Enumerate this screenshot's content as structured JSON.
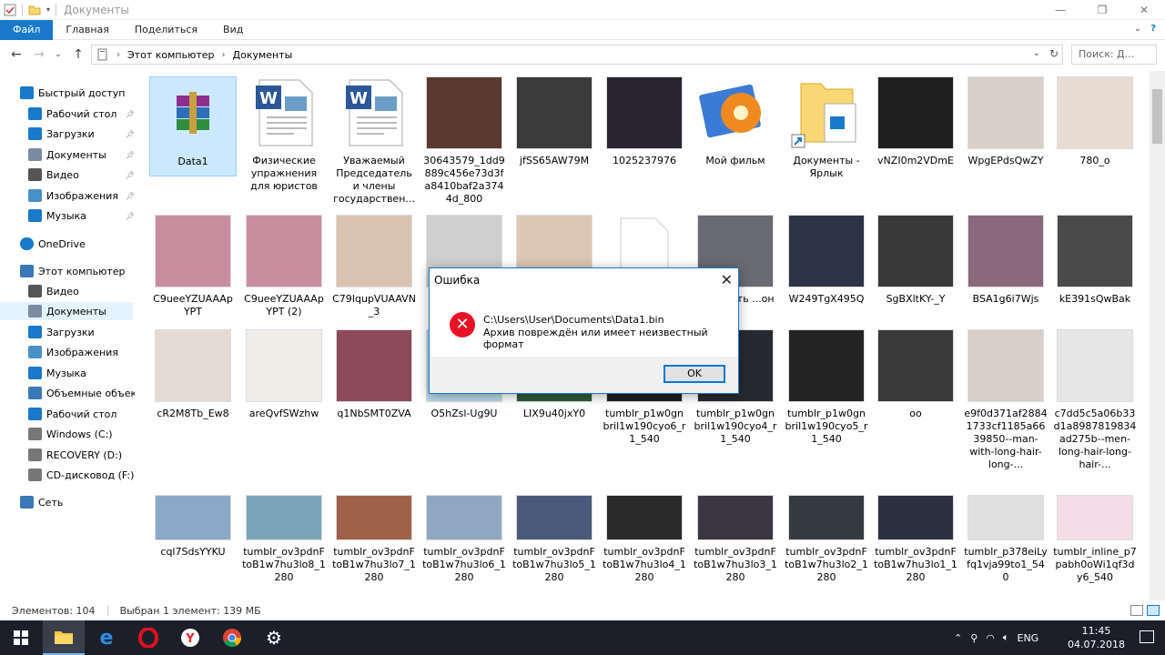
{
  "window": {
    "title": "Документы",
    "minimize": "—",
    "maximize": "❐",
    "close": "✕"
  },
  "ribbon": {
    "tabs": [
      "Файл",
      "Главная",
      "Поделиться",
      "Вид"
    ]
  },
  "address": {
    "crumbs": [
      "Этот компьютер",
      "Документы"
    ],
    "search_placeholder": "Поиск: Д..."
  },
  "sidebar": {
    "items": [
      {
        "label": "Быстрый доступ",
        "icon": "star-icon"
      },
      {
        "label": "Рабочий стол",
        "icon": "desktop-icon"
      },
      {
        "label": "Загрузки",
        "icon": "download-icon"
      },
      {
        "label": "Документы",
        "icon": "documents-icon"
      },
      {
        "label": "Видео",
        "icon": "video-icon"
      },
      {
        "label": "Изображения",
        "icon": "pictures-icon"
      },
      {
        "label": "Музыка",
        "icon": "music-icon"
      },
      {
        "label": "OneDrive",
        "icon": "cloud-icon"
      },
      {
        "label": "Этот компьютер",
        "icon": "computer-icon"
      },
      {
        "label": "Видео",
        "icon": "video-icon"
      },
      {
        "label": "Документы",
        "icon": "documents-icon"
      },
      {
        "label": "Загрузки",
        "icon": "download-icon"
      },
      {
        "label": "Изображения",
        "icon": "pictures-icon"
      },
      {
        "label": "Музыка",
        "icon": "music-icon"
      },
      {
        "label": "Объемные объекты",
        "icon": "3d-objects-icon"
      },
      {
        "label": "Рабочий стол",
        "icon": "desktop-icon"
      },
      {
        "label": "Windows (C:)",
        "icon": "drive-icon"
      },
      {
        "label": "RECOVERY (D:)",
        "icon": "drive-icon"
      },
      {
        "label": "CD-дисковод (F:)",
        "icon": "cd-drive-icon"
      },
      {
        "label": "Сеть",
        "icon": "network-icon"
      }
    ]
  },
  "files": [
    {
      "name": "Data1",
      "type": "archive",
      "selected": true
    },
    {
      "name": "Физические упражнения для юристов",
      "type": "word"
    },
    {
      "name": "Уважаемый Председатель и члены государствен...",
      "type": "word"
    },
    {
      "name": "30643579_1dd9889c456e73d3fa8410baf2a3744d_800",
      "type": "photo",
      "color": "#5a3a2e"
    },
    {
      "name": "jfSS65AW79M",
      "type": "photo",
      "color": "#3b3b3b"
    },
    {
      "name": "1025237976",
      "type": "photo",
      "color": "#2a2430"
    },
    {
      "name": "Мой фильм",
      "type": "movie"
    },
    {
      "name": "Документы - Ярлык",
      "type": "folder-shortcut"
    },
    {
      "name": "vNZI0m2VDmE",
      "type": "photo",
      "color": "#1f1f1f"
    },
    {
      "name": "WpgEPdsQwZY",
      "type": "photo",
      "color": "#d8cfc7"
    },
    {
      "name": "780_o",
      "type": "photo",
      "color": "#e8dcd2"
    },
    {
      "name": "C9ueeYZUAAApYPT",
      "type": "photo",
      "color": "#c98da0"
    },
    {
      "name": "C9ueeYZUAAApYPT (2)",
      "type": "photo",
      "color": "#c98da0"
    },
    {
      "name": "C79IqupVUAAVN_3",
      "type": "photo",
      "color": "#d9c2b0"
    },
    {
      "name": "",
      "type": "photo",
      "color": "#cfcfcf"
    },
    {
      "name": "",
      "type": "photo",
      "color": "#dcc6b4"
    },
    {
      "name": "",
      "type": "blank"
    },
    {
      "name": "...енность ...он",
      "type": "photo",
      "color": "#6a6a72"
    },
    {
      "name": "W249TgX495Q",
      "type": "photo",
      "color": "#2c3346"
    },
    {
      "name": "SgBXltKY-_Y",
      "type": "photo",
      "color": "#383838"
    },
    {
      "name": "BSA1g6i7Wjs",
      "type": "photo",
      "color": "#8a6a7a"
    },
    {
      "name": "kE391sQwBak",
      "type": "photo",
      "color": "#4a4a4a"
    },
    {
      "name": "cR2M8Tb_Ew8",
      "type": "photo",
      "color": "#e4dcd4"
    },
    {
      "name": "areQvfSWzhw",
      "type": "photo",
      "color": "#f0ece8"
    },
    {
      "name": "q1NbSMT0ZVA",
      "type": "photo",
      "color": "#8b4a5a"
    },
    {
      "name": "O5hZsl-Ug9U",
      "type": "photo",
      "color": "#b7d6e8"
    },
    {
      "name": "LIX9u40jxY0",
      "type": "photo",
      "color": "#2e5a3a"
    },
    {
      "name": "tumblr_p1w0gnbril1w190cyo6_r1_540",
      "type": "photo",
      "color": "#202020"
    },
    {
      "name": "tumblr_p1w0gnbril1w190cyo4_r1_540",
      "type": "photo",
      "color": "#262a30"
    },
    {
      "name": "tumblr_p1w0gnbril1w190cyo5_r1_540",
      "type": "photo",
      "color": "#242424"
    },
    {
      "name": "oo",
      "type": "photo",
      "color": "#3a3a3a"
    },
    {
      "name": "e9f0d371af28841733cf1185a6639850--man-with-long-hair-long-...",
      "type": "photo",
      "color": "#d7cfc8"
    },
    {
      "name": "c7dd5c5a06b33d1a8987819834ad275b--men-long-hair-long-hair-...",
      "type": "photo",
      "color": "#e6e6e6"
    },
    {
      "name": "cql7SdsYYKU",
      "type": "photo",
      "color": "#8aa8c8"
    },
    {
      "name": "tumblr_ov3pdnFtoB1w7hu3lo8_1280",
      "type": "photo",
      "color": "#7aa5b8"
    },
    {
      "name": "tumblr_ov3pdnFtoB1w7hu3lo7_1280",
      "type": "photo",
      "color": "#a0614a"
    },
    {
      "name": "tumblr_ov3pdnFtoB1w7hu3lo6_1280",
      "type": "photo",
      "color": "#8fa7c0"
    },
    {
      "name": "tumblr_ov3pdnFtoB1w7hu3lo5_1280",
      "type": "photo",
      "color": "#4a5a7a"
    },
    {
      "name": "tumblr_ov3pdnFtoB1w7hu3lo4_1280",
      "type": "photo",
      "color": "#2a2a2a"
    },
    {
      "name": "tumblr_ov3pdnFtoB1w7hu3lo3_1280",
      "type": "photo",
      "color": "#3a3540"
    },
    {
      "name": "tumblr_ov3pdnFtoB1w7hu3lo2_1280",
      "type": "photo",
      "color": "#343a40"
    },
    {
      "name": "tumblr_ov3pdnFtoB1w7hu3lo1_1280",
      "type": "photo",
      "color": "#2c3040"
    },
    {
      "name": "tumblr_p378eiLyfq1vja99to1_540",
      "type": "photo",
      "color": "#e0e0e0"
    },
    {
      "name": "tumblr_inline_p7pabh0oWi1qf3dy6_540",
      "type": "photo",
      "color": "#f4dde6"
    }
  ],
  "status": {
    "count": "Элементов: 104",
    "selected": "Выбран 1 элемент: 139 МБ"
  },
  "dialog": {
    "title": "Ошибка",
    "close": "✕",
    "path": "C:\\Users\\User\\Documents\\Data1.bin",
    "message": "Архив повреждён или имеет неизвестный формат",
    "ok": "OK"
  },
  "taskbar": {
    "lang": "ENG",
    "time": "11:45",
    "date": "04.07.2018",
    "apps": [
      "start-icon",
      "file-explorer-icon",
      "edge-icon",
      "opera-icon",
      "yandex-icon",
      "chrome-icon",
      "settings-icon"
    ]
  }
}
